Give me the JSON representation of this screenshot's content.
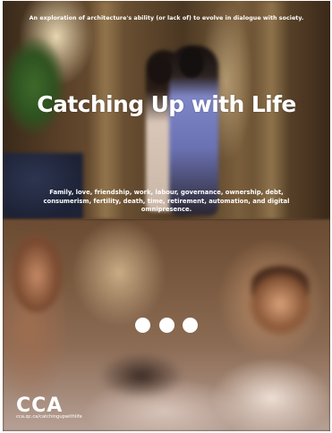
{
  "poster": {
    "tagline": "An exploration of architecture's ability (or lack of) to evolve in dialogue with society.",
    "title": "Catching Up with Life",
    "themes": "Family, love, friendship, work, labour, governance, ownership, debt, consumerism, fertility, death, time, retirement, automation, and digital omnipresence.",
    "logo": "CCA",
    "url": "cca.qc.ca/catchingupwithlife"
  },
  "icons": {
    "more": "ellipsis-dots-icon"
  },
  "colors": {
    "text": "#ffffff"
  }
}
